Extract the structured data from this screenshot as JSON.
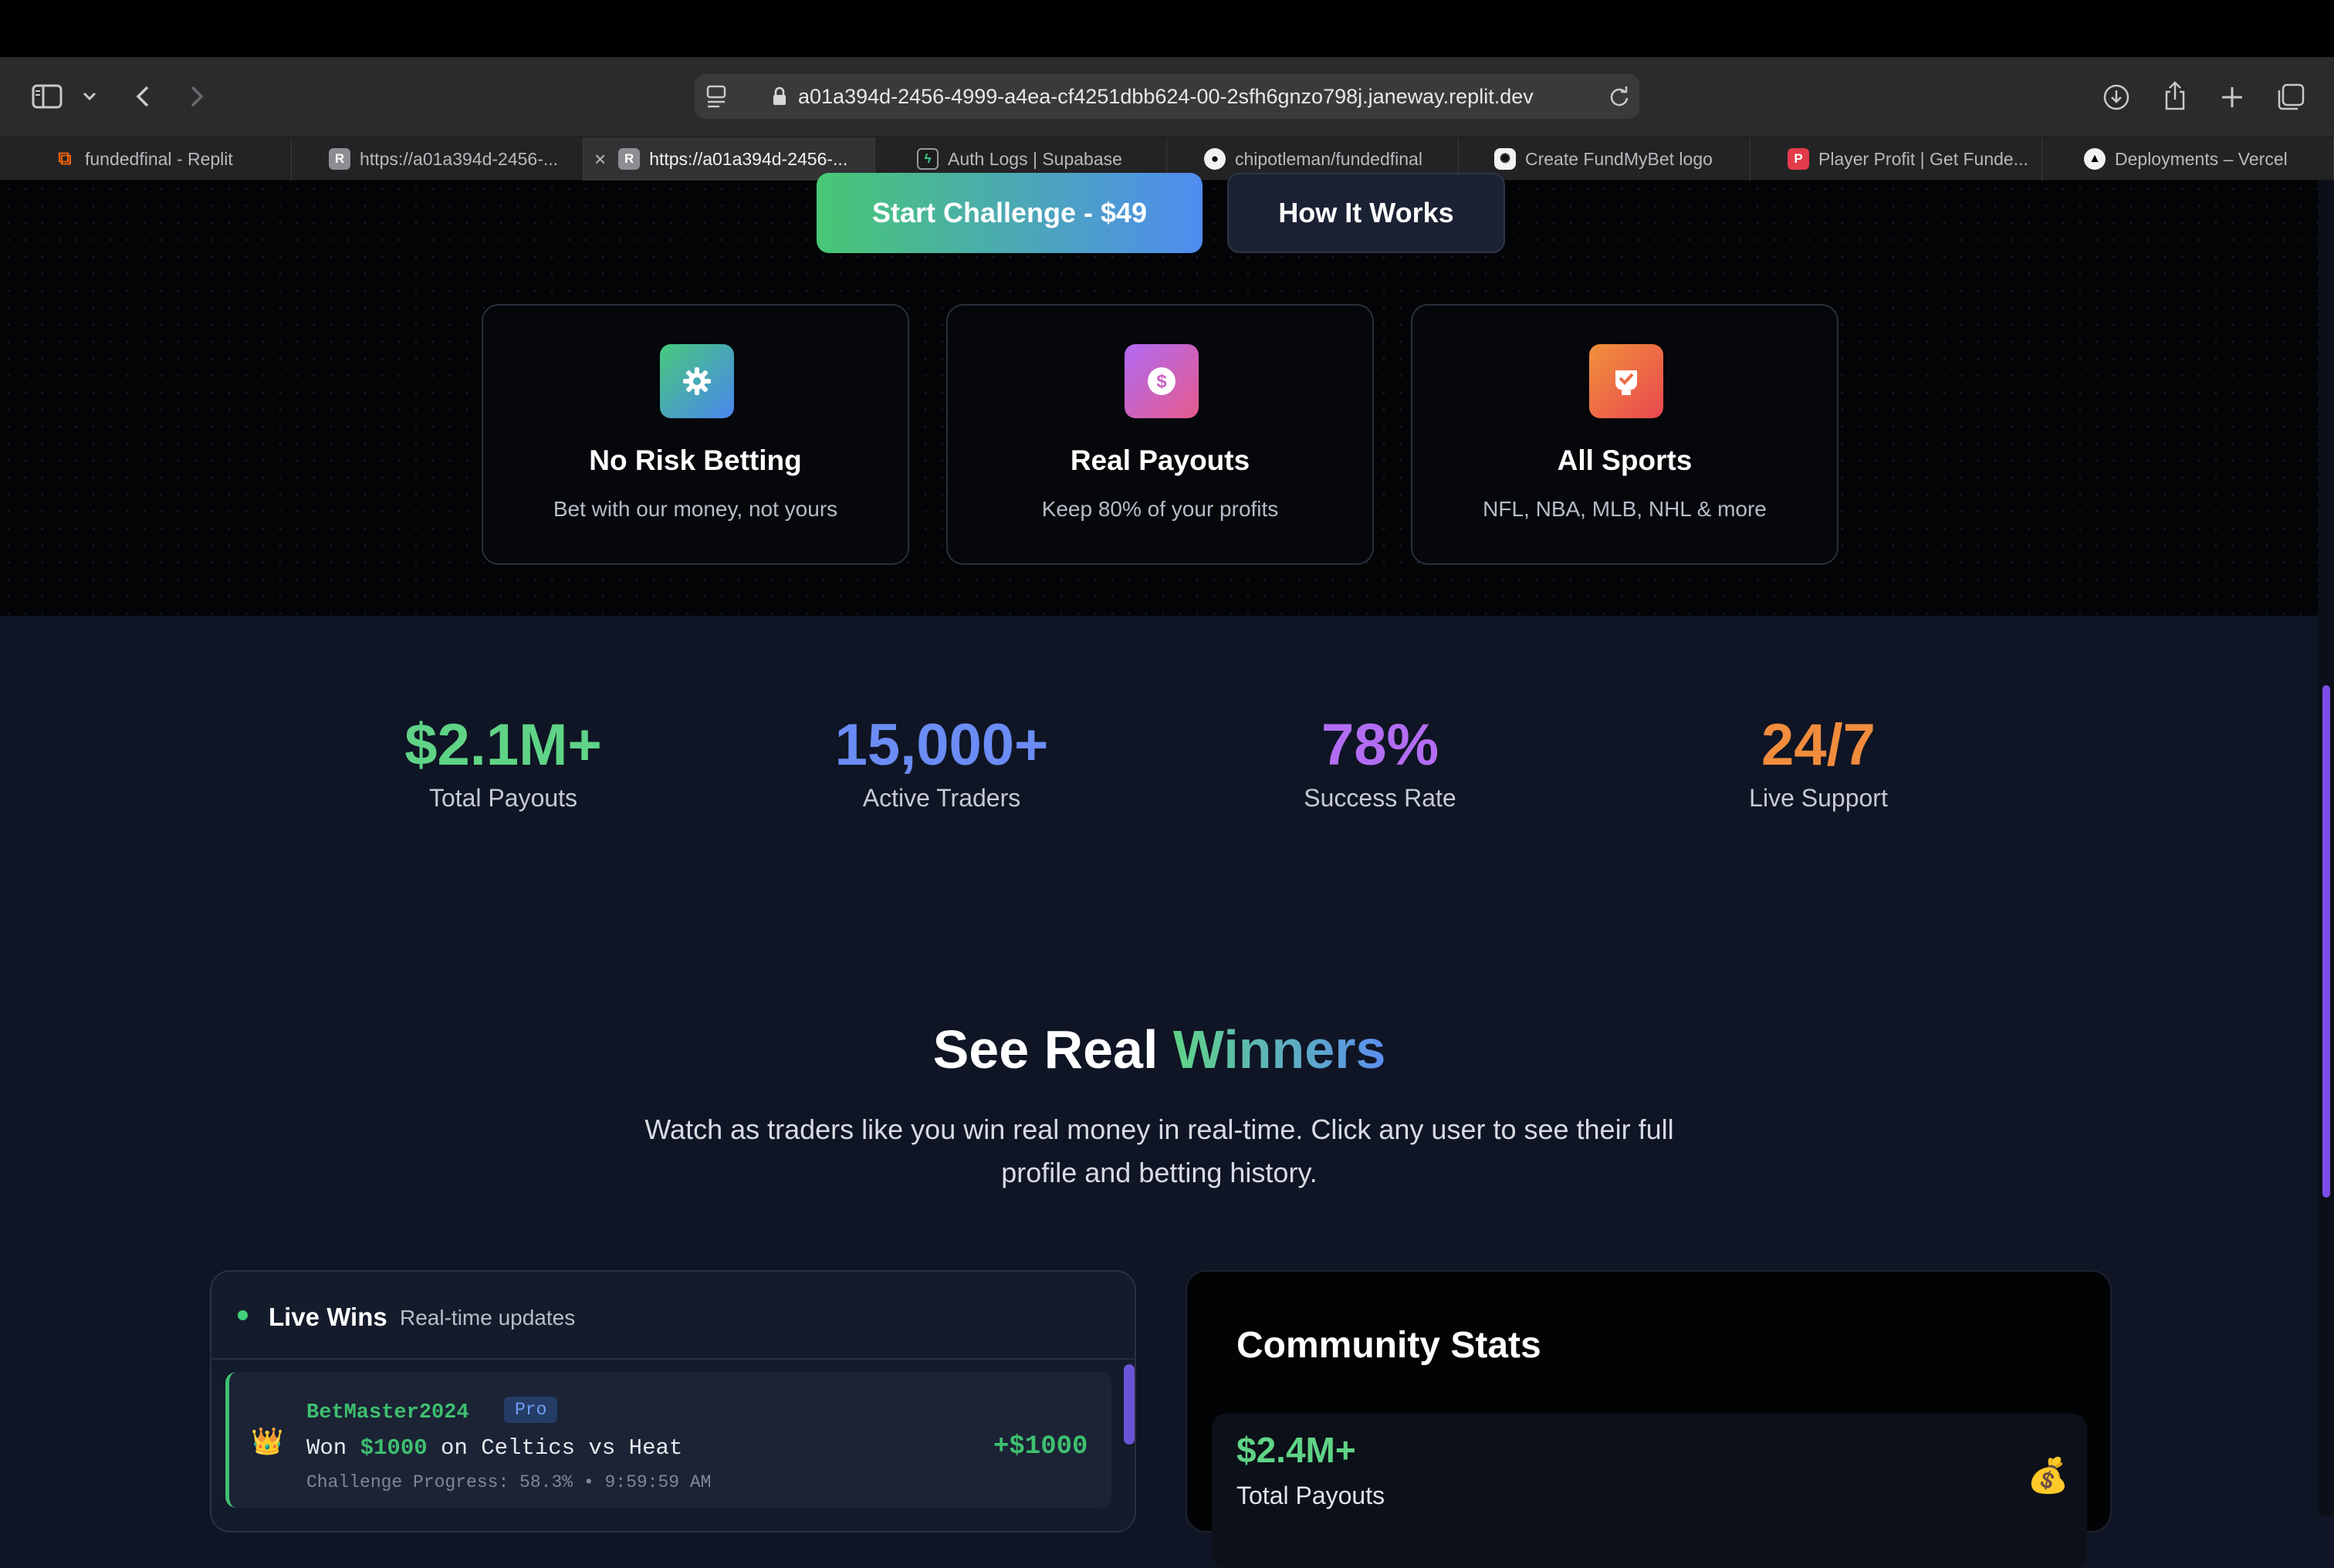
{
  "browser": {
    "url": "a01a394d-2456-4999-a4ea-cf4251dbb624-00-2sfh6gnzo798j.janeway.replit.dev",
    "tabs": [
      {
        "label": "fundedfinal - Replit",
        "icon": "replit-icon"
      },
      {
        "label": "https://a01a394d-2456-...",
        "icon": "replit-r-icon"
      },
      {
        "label": "https://a01a394d-2456-...",
        "icon": "replit-r-icon",
        "active": true
      },
      {
        "label": "Auth Logs | Supabase",
        "icon": "supabase-icon"
      },
      {
        "label": "chipotleman/fundedfinal",
        "icon": "github-icon"
      },
      {
        "label": "Create FundMyBet logo",
        "icon": "openai-icon"
      },
      {
        "label": "Player Profit | Get Funde...",
        "icon": "playerprofit-icon"
      },
      {
        "label": "Deployments – Vercel",
        "icon": "vercel-icon"
      }
    ]
  },
  "hero": {
    "primary_button": "Start Challenge - $49",
    "secondary_button": "How It Works",
    "features": [
      {
        "icon": "gear-icon",
        "title": "No Risk Betting",
        "desc": "Bet with our money, not yours"
      },
      {
        "icon": "dollar-icon",
        "title": "Real Payouts",
        "desc": "Keep 80% of your profits"
      },
      {
        "icon": "trophy-icon",
        "title": "All Sports",
        "desc": "NFL, NBA, MLB, NHL & more"
      }
    ]
  },
  "stats": [
    {
      "value": "$2.1M+",
      "label": "Total Payouts",
      "color": "#5fd386"
    },
    {
      "value": "15,000+",
      "label": "Active Traders",
      "color": "#6b8cf5"
    },
    {
      "value": "78%",
      "label": "Success Rate",
      "color": "#b26df2"
    },
    {
      "value": "24/7",
      "label": "Live Support",
      "color": "#f08c3c"
    }
  ],
  "winners": {
    "title_plain": "See Real ",
    "title_highlight": "Winners",
    "subtitle": "Watch as traders like you win real money in real-time. Click any user to see their full profile and betting history."
  },
  "live_wins": {
    "title": "Live Wins",
    "subtitle": "Real-time updates",
    "entry": {
      "user": "BetMaster2024",
      "tier": "Pro",
      "won_prefix": "Won ",
      "amount": "$1000",
      "match": " on Celtics vs Heat",
      "meta": "Challenge Progress: 58.3% • 9:59:59 AM",
      "delta": "+$1000",
      "avatar_icon": "crown-icon"
    }
  },
  "community": {
    "title": "Community Stats",
    "stat_value": "$2.4M+",
    "stat_label": "Total Payouts",
    "stat_icon": "money-bag-icon"
  }
}
